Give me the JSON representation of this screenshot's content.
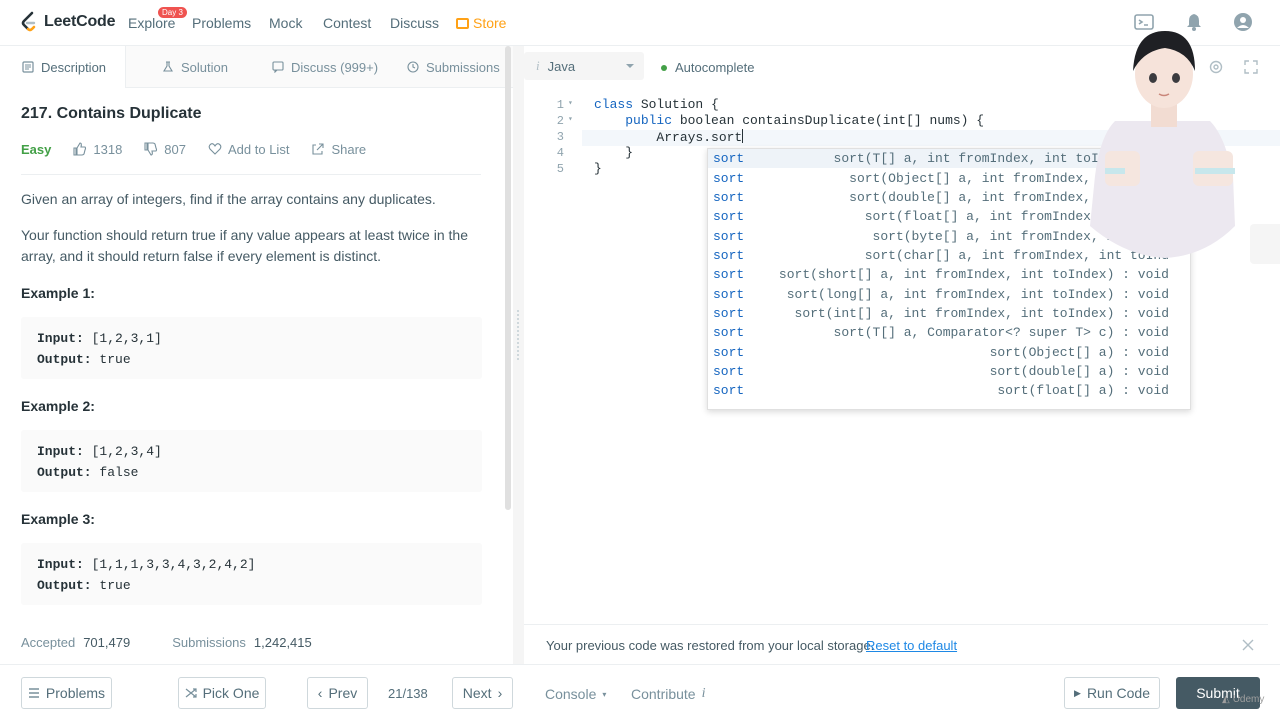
{
  "nav": {
    "brand": "LeetCode",
    "items": [
      "Explore",
      "Problems",
      "Mock",
      "Contest",
      "Discuss"
    ],
    "explore_badge": "Day 3",
    "store": "Store"
  },
  "tabs": {
    "description": "Description",
    "solution": "Solution",
    "discuss": "Discuss (999+)",
    "submissions": "Submissions"
  },
  "problem": {
    "title": "217. Contains Duplicate",
    "difficulty": "Easy",
    "likes": "1318",
    "dislikes": "807",
    "add_to_list": "Add to List",
    "share": "Share",
    "para1": "Given an array of integers, find if the array contains any duplicates.",
    "para2": "Your function should return true if any value appears at least twice in the array, and it should return false if every element is distinct.",
    "examples": [
      {
        "title": "Example 1:",
        "input_label": "Input:",
        "input": "[1,2,3,1]",
        "output_label": "Output:",
        "output": "true"
      },
      {
        "title": "Example 2:",
        "input_label": "Input:",
        "input": "[1,2,3,4]",
        "output_label": "Output:",
        "output": "false"
      },
      {
        "title": "Example 3:",
        "input_label": "Input:",
        "input": "[1,1,1,3,3,4,3,2,4,2]",
        "output_label": "Output:",
        "output": "true"
      }
    ],
    "accepted_label": "Accepted",
    "accepted": "701,479",
    "submissions_label": "Submissions",
    "submissions": "1,242,415"
  },
  "editor": {
    "language_icon": "i",
    "language": "Java",
    "autocomplete": "Autocomplete",
    "lines": [
      {
        "num": "1",
        "fold": "▾",
        "kw1": "class",
        "rest": " Solution {"
      },
      {
        "num": "2",
        "fold": "▾",
        "indent": "    ",
        "kw1": "public",
        "rest": " boolean containsDuplicate(int[] nums) {"
      },
      {
        "num": "3",
        "fold": "",
        "indent": "        ",
        "kw1": "",
        "rest": "Arrays.sort"
      },
      {
        "num": "4",
        "fold": "",
        "indent": "    ",
        "kw1": "",
        "rest": "}"
      },
      {
        "num": "5",
        "fold": "",
        "indent": "",
        "kw1": "",
        "rest": "}"
      }
    ],
    "suggestions": [
      {
        "name": "sort",
        "sig": "sort(T[] a, int fromIndex, int toIndex, Com"
      },
      {
        "name": "sort",
        "sig": "sort(Object[] a, int fromIndex, int toInd"
      },
      {
        "name": "sort",
        "sig": "sort(double[] a, int fromIndex, int toInd"
      },
      {
        "name": "sort",
        "sig": "sort(float[] a, int fromIndex, int toIn"
      },
      {
        "name": "sort",
        "sig": "sort(byte[] a, int fromIndex, int toIr"
      },
      {
        "name": "sort",
        "sig": "sort(char[] a, int fromIndex, int toInd"
      },
      {
        "name": "sort",
        "sig": "sort(short[] a, int fromIndex, int toIndex) : void"
      },
      {
        "name": "sort",
        "sig": "sort(long[] a, int fromIndex, int toIndex) : void"
      },
      {
        "name": "sort",
        "sig": "sort(int[] a, int fromIndex, int toIndex) : void"
      },
      {
        "name": "sort",
        "sig": "sort(T[] a, Comparator<? super T> c) : void"
      },
      {
        "name": "sort",
        "sig": "sort(Object[] a) : void"
      },
      {
        "name": "sort",
        "sig": "sort(double[] a) : void"
      },
      {
        "name": "sort",
        "sig": "sort(float[] a) : void"
      }
    ]
  },
  "notice": {
    "text": "Your previous code was restored from your local storage.",
    "link": "Reset to default"
  },
  "bottom": {
    "problems": "Problems",
    "pick_one": "Pick One",
    "prev": "Prev",
    "page": "21/138",
    "next": "Next",
    "console": "Console",
    "contribute": "Contribute",
    "contribute_icon": "i",
    "run_code": "Run Code",
    "submit": "Submit"
  },
  "watermark": "Udemy",
  "colors": {
    "accent_store": "#ffa116",
    "easy": "#43a047",
    "keyword": "#1565c0",
    "submit_bg": "#455a64"
  }
}
